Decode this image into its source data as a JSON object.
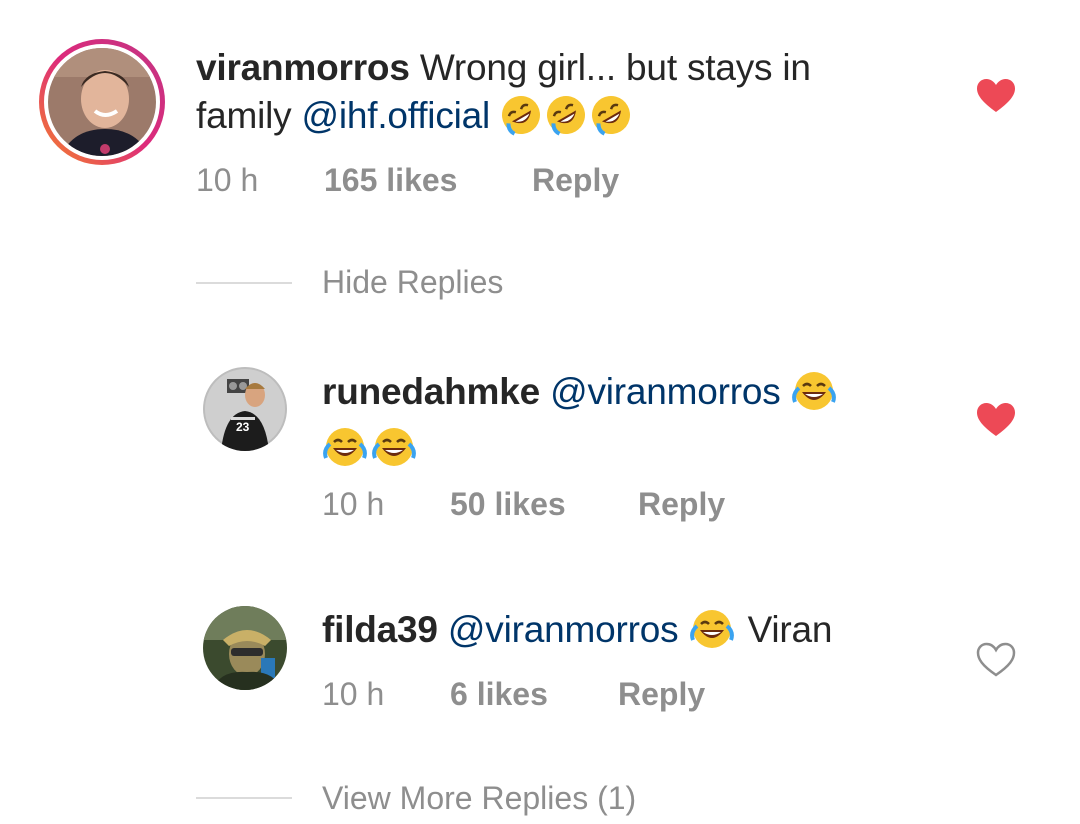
{
  "comments": [
    {
      "username": "viranmorros",
      "text": "Wrong girl... but stays in",
      "text2": "family",
      "mention": "@ihf.official",
      "emoji": "rolling-on-floor-laughing",
      "time": "10 h",
      "likes": "165 likes",
      "reply": "Reply",
      "liked": true,
      "avatar": "avatar-viranmorros"
    }
  ],
  "replies_toggle": {
    "hide_label": "Hide Replies",
    "more_label": "View More Replies (1)"
  },
  "replies": [
    {
      "username": "runedahmke",
      "mention": "@viranmorros",
      "emoji": "face-with-tears-of-joy",
      "time": "10 h",
      "likes": "50 likes",
      "reply": "Reply",
      "liked": true,
      "jersey_number": "23"
    },
    {
      "username": "filda39",
      "mention": "@viranmorros",
      "emoji": "face-with-tears-of-joy",
      "suffix": "Viran",
      "time": "10 h",
      "likes": "6 likes",
      "reply": "Reply",
      "liked": false
    }
  ],
  "colors": {
    "heart_liked": "#ed4956",
    "mention": "#003569",
    "meta": "#8e8e8e",
    "story_ring_start": "#f58529",
    "story_ring_end": "#dd2a7b"
  }
}
